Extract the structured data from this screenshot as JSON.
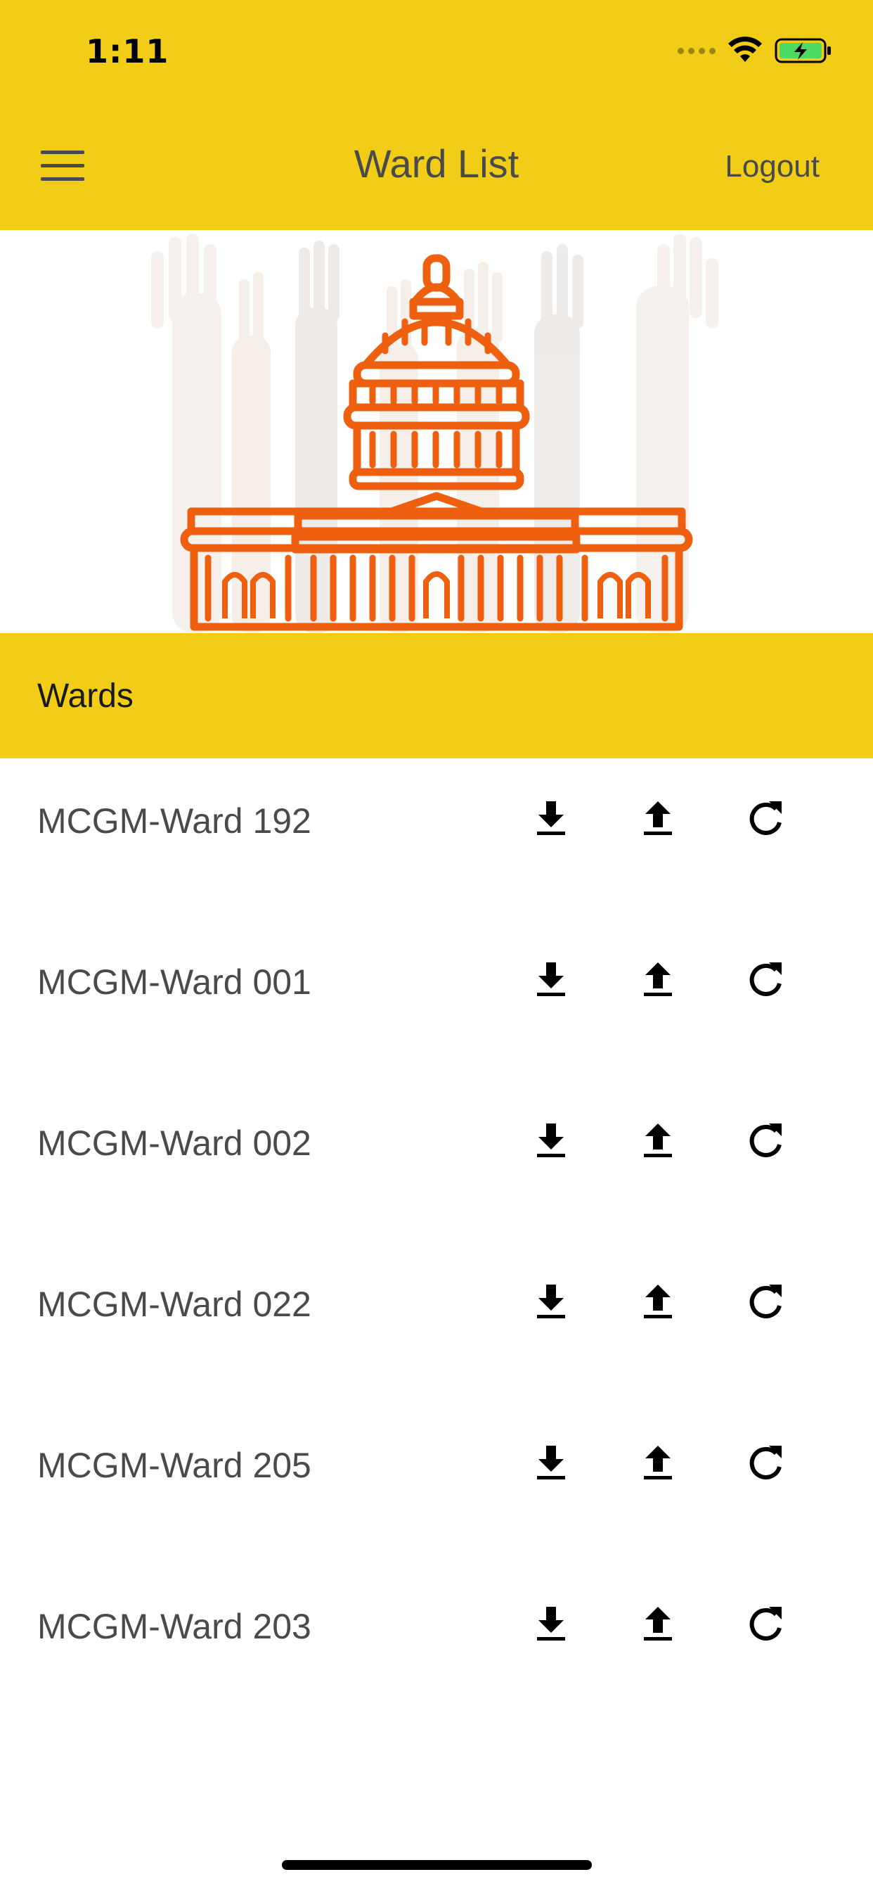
{
  "status_bar": {
    "time": "1:11",
    "icons": [
      "cellular-signal-icon",
      "wifi-icon",
      "battery-charging-icon"
    ]
  },
  "header": {
    "menu_icon": "hamburger-menu-icon",
    "title": "Ward List",
    "logout_label": "Logout"
  },
  "banner": {
    "image": "capitol-building-with-raised-hands-illustration"
  },
  "section": {
    "title": "Wards"
  },
  "wards": [
    {
      "name": "MCGM-Ward 192"
    },
    {
      "name": "MCGM-Ward 001"
    },
    {
      "name": "MCGM-Ward 002"
    },
    {
      "name": "MCGM-Ward 022"
    },
    {
      "name": "MCGM-Ward 205"
    },
    {
      "name": "MCGM-Ward 203"
    }
  ],
  "row_actions": [
    "download-icon",
    "upload-icon",
    "refresh-icon"
  ],
  "colors": {
    "brand_yellow": "#F2CD17",
    "capitol_orange": "#EE5F0F",
    "text_dark": "#4a4a4a",
    "battery_green": "#4CD964"
  }
}
